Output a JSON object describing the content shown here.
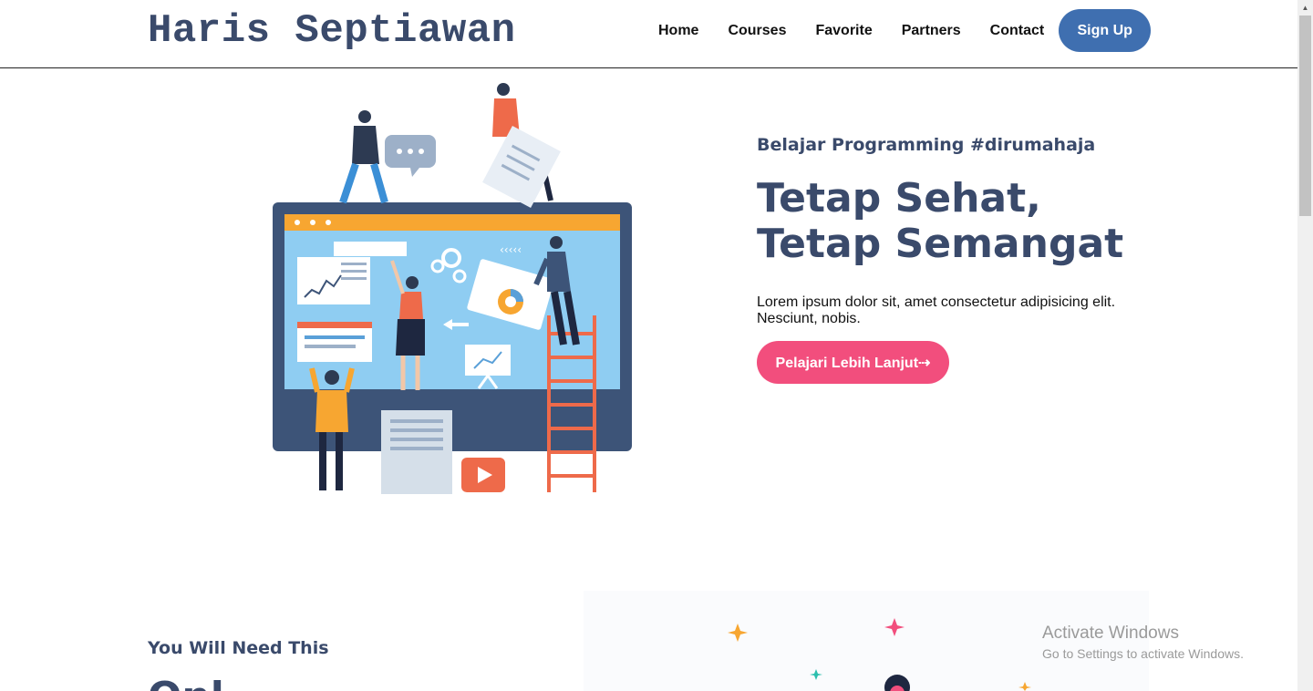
{
  "header": {
    "brand": "Haris Septiawan",
    "nav": [
      "Home",
      "Courses",
      "Favorite",
      "Partners",
      "Contact"
    ],
    "signup_label": "Sign Up"
  },
  "hero": {
    "kicker": "Belajar Programming #dirumahaja",
    "headline_line1": "Tetap Sehat,",
    "headline_line2": "Tetap Semangat",
    "description": "Lorem ipsum dolor sit, amet consectetur adipisicing elit. Nesciunt, nobis.",
    "cta_label": "Pelajari Lebih Lanjut⇢",
    "illustration_icon": "online-learning-illustration"
  },
  "section2": {
    "kicker": "You Will Need This",
    "title_fragment": "Onl",
    "art_icon": "sparkles-character-illustration"
  },
  "watermark": {
    "line1": "Activate Windows",
    "line2": "Go to Settings to activate Windows."
  },
  "colors": {
    "brand_text": "#3a4a6b",
    "signup_bg": "#3f6fb0",
    "cta_bg": "#f24e7d"
  }
}
